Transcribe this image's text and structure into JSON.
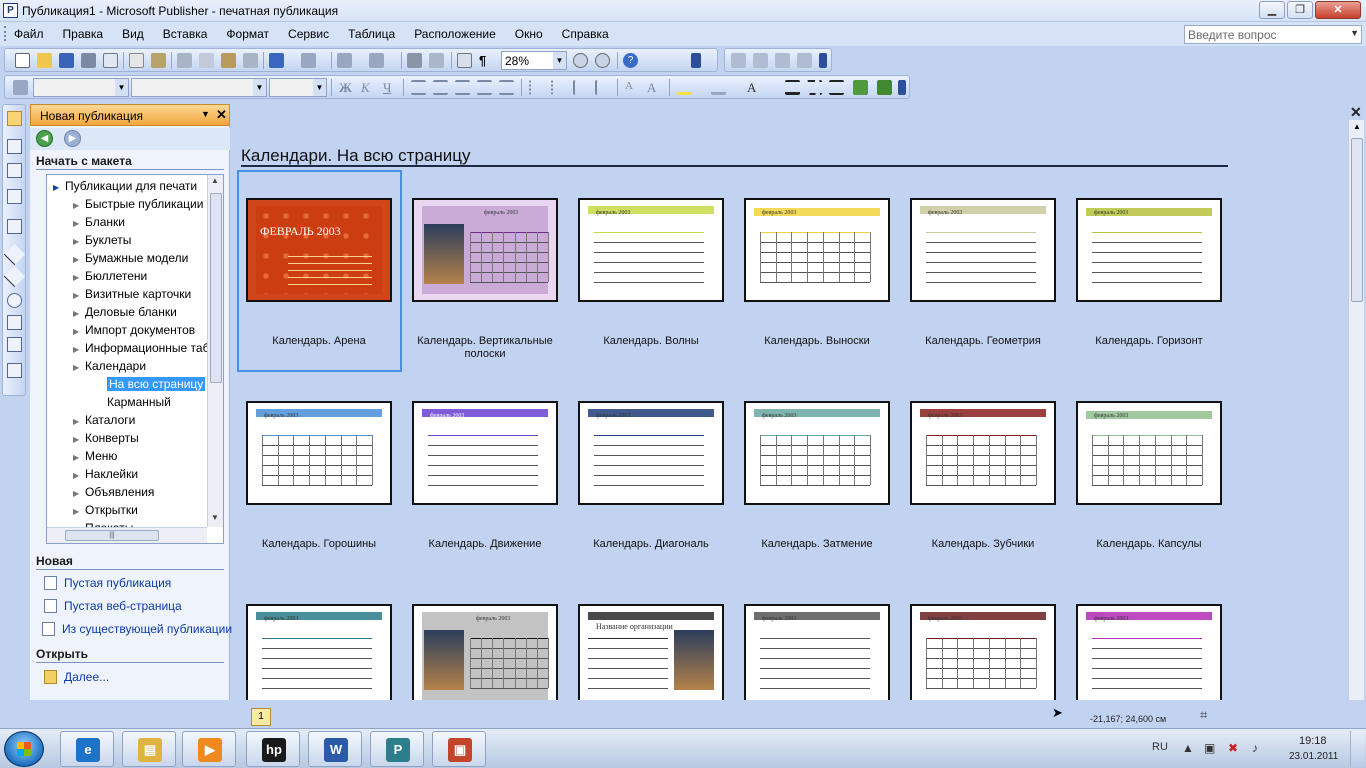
{
  "window": {
    "title": "Публикация1 - Microsoft Publisher - печатная публикация",
    "app_letter": "P"
  },
  "menu": [
    "Файл",
    "Правка",
    "Вид",
    "Вставка",
    "Формат",
    "Сервис",
    "Таблица",
    "Расположение",
    "Окно",
    "Справка"
  ],
  "ask_box": {
    "placeholder": "Введите вопрос"
  },
  "toolbar": {
    "zoom": "28%"
  },
  "task_pane": {
    "title": "Новая публикация",
    "start_section": "Начать с макета",
    "tree": [
      {
        "label": "Публикации для печати",
        "level": 0
      },
      {
        "label": "Быстрые публикации",
        "level": 1
      },
      {
        "label": "Бланки",
        "level": 1
      },
      {
        "label": "Буклеты",
        "level": 1
      },
      {
        "label": "Бумажные модели",
        "level": 1
      },
      {
        "label": "Бюллетени",
        "level": 1
      },
      {
        "label": "Визитные карточки",
        "level": 1
      },
      {
        "label": "Деловые бланки",
        "level": 1
      },
      {
        "label": "Импорт документов",
        "level": 1
      },
      {
        "label": "Информационные таблицы",
        "level": 1
      },
      {
        "label": "Календари",
        "level": 1
      },
      {
        "label": "На всю страницу",
        "level": 2,
        "selected": true
      },
      {
        "label": "Карманный",
        "level": 2
      },
      {
        "label": "Каталоги",
        "level": 1
      },
      {
        "label": "Конверты",
        "level": 1
      },
      {
        "label": "Меню",
        "level": 1
      },
      {
        "label": "Наклейки",
        "level": 1
      },
      {
        "label": "Объявления",
        "level": 1
      },
      {
        "label": "Открытки",
        "level": 1
      },
      {
        "label": "Плакаты",
        "level": 1
      }
    ],
    "new_section": "Новая",
    "new_links": [
      "Пустая публикация",
      "Пустая веб-страница",
      "Из существующей публикации..."
    ],
    "open_section": "Открыть",
    "open_link": "Далее..."
  },
  "gallery": {
    "title": "Календари. На всю страницу",
    "items": [
      {
        "caption": "Календарь. Арена",
        "thumb_text": "ФЕВРАЛЬ 2003",
        "selected": true
      },
      {
        "caption": "Календарь. Вертикальные полоски",
        "thumb_text": "февраль 2003"
      },
      {
        "caption": "Календарь. Волны",
        "thumb_text": "февраль 2003"
      },
      {
        "caption": "Календарь. Выноски",
        "thumb_text": "февраль 2003"
      },
      {
        "caption": "Календарь. Геометрия",
        "thumb_text": "февраль 2003"
      },
      {
        "caption": "Календарь. Горизонт",
        "thumb_text": "февраль 2003"
      },
      {
        "caption": "Календарь. Горошины",
        "thumb_text": "февраль 2003"
      },
      {
        "caption": "Календарь. Движение",
        "thumb_text": "февраль 2003"
      },
      {
        "caption": "Календарь. Диагональ",
        "thumb_text": "февраль 2003"
      },
      {
        "caption": "Календарь. Затмение",
        "thumb_text": "февраль 2003"
      },
      {
        "caption": "Календарь. Зубчики",
        "thumb_text": "февраль 2003"
      },
      {
        "caption": "Календарь. Капсулы",
        "thumb_text": "февраль 2003"
      },
      {
        "caption": "",
        "thumb_text": "февраль 2003"
      },
      {
        "caption": "",
        "thumb_text": "февраль 2003"
      },
      {
        "caption": "",
        "thumb_text": "Название организации"
      },
      {
        "caption": "",
        "thumb_text": "февраль 2003"
      },
      {
        "caption": "",
        "thumb_text": "февраль 2003"
      },
      {
        "caption": "",
        "thumb_text": "февраль 2003"
      }
    ]
  },
  "status": {
    "page": "1",
    "coords": "-21,167; 24,600 см"
  },
  "taskbar": {
    "lang": "RU",
    "time": "19:18",
    "date": "23.01.2011",
    "apps": [
      {
        "name": "internet-explorer",
        "letter": "e",
        "color": "#1e73c8"
      },
      {
        "name": "explorer",
        "letter": "▤",
        "color": "#e0b340"
      },
      {
        "name": "media-player",
        "letter": "▶",
        "color": "#f08a1e"
      },
      {
        "name": "hp",
        "letter": "hp",
        "color": "#1a1a1a"
      },
      {
        "name": "word",
        "letter": "W",
        "color": "#2a5aa8"
      },
      {
        "name": "publisher",
        "letter": "P",
        "color": "#2c7f8a"
      },
      {
        "name": "powerpoint",
        "letter": "▣",
        "color": "#c3452b"
      }
    ]
  }
}
